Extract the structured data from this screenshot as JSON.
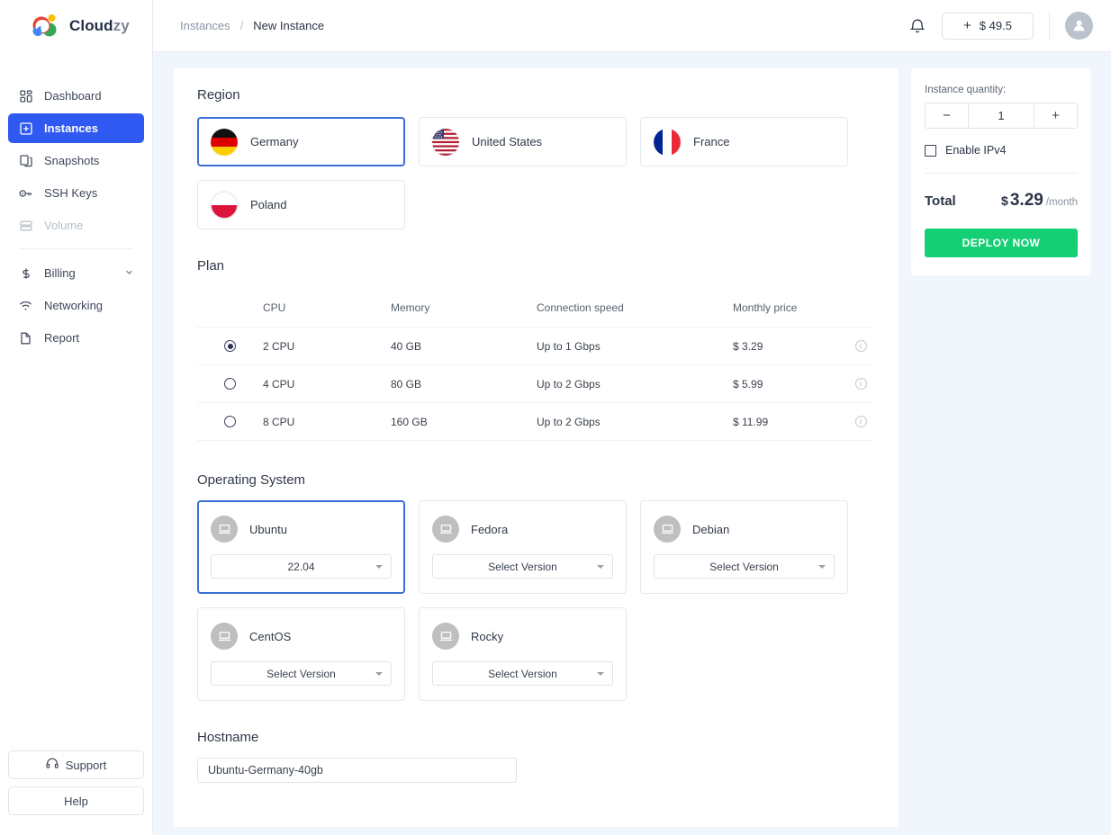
{
  "brand": {
    "name_main": "Cloud",
    "name_accent": "zy",
    "logo_icon": "cloudzy-logo-icon"
  },
  "topbar": {
    "breadcrumb": {
      "parent": "Instances",
      "separator": "/",
      "current": "New Instance"
    },
    "bell_icon": "notification-bell-icon",
    "credit": {
      "plus": "+",
      "amount": "$ 49.5"
    },
    "avatar_icon": "user-avatar-icon"
  },
  "sidebar": {
    "items": [
      {
        "label": "Dashboard",
        "icon": "dashboard-grid-icon",
        "state": "default"
      },
      {
        "label": "Instances",
        "icon": "instances-plus-box-icon",
        "state": "active"
      },
      {
        "label": "Snapshots",
        "icon": "snapshots-copy-icon",
        "state": "default"
      },
      {
        "label": "SSH Keys",
        "icon": "ssh-key-icon",
        "state": "default"
      },
      {
        "label": "Volume",
        "icon": "volume-storage-icon",
        "state": "disabled"
      },
      {
        "label": "Billing",
        "icon": "billing-dollar-icon",
        "state": "default",
        "chevron": "chevron-down-icon"
      },
      {
        "label": "Networking",
        "icon": "networking-wifi-icon",
        "state": "default"
      },
      {
        "label": "Report",
        "icon": "report-document-icon",
        "state": "default"
      }
    ],
    "support_label": "Support",
    "support_icon": "headset-icon",
    "help_label": "Help"
  },
  "sections": {
    "region_title": "Region",
    "plan_title": "Plan",
    "os_title": "Operating System",
    "hostname_title": "Hostname"
  },
  "regions": [
    {
      "label": "Germany",
      "flag": "flag-germany",
      "selected": true
    },
    {
      "label": "United States",
      "flag": "flag-united-states",
      "selected": false
    },
    {
      "label": "France",
      "flag": "flag-france",
      "selected": false
    },
    {
      "label": "Poland",
      "flag": "flag-poland",
      "selected": false
    }
  ],
  "plan_table": {
    "columns": [
      "",
      "CPU",
      "Memory",
      "Connection speed",
      "Monthly price",
      ""
    ],
    "rows": [
      {
        "selected": true,
        "cpu": "2 CPU",
        "memory": "40 GB",
        "speed": "Up to 1 Gbps",
        "price": "$ 3.29",
        "info_icon": "info-circle-icon"
      },
      {
        "selected": false,
        "cpu": "4 CPU",
        "memory": "80 GB",
        "speed": "Up to 2 Gbps",
        "price": "$ 5.99",
        "info_icon": "info-circle-icon"
      },
      {
        "selected": false,
        "cpu": "8 CPU",
        "memory": "160 GB",
        "speed": "Up to 2 Gbps",
        "price": "$ 11.99",
        "info_icon": "info-circle-icon"
      }
    ]
  },
  "operating_systems": [
    {
      "name": "Ubuntu",
      "version": "22.04",
      "selected": true,
      "icon": "os-monitor-icon"
    },
    {
      "name": "Fedora",
      "version": "Select Version",
      "selected": false,
      "icon": "os-monitor-icon"
    },
    {
      "name": "Debian",
      "version": "Select Version",
      "selected": false,
      "icon": "os-monitor-icon"
    },
    {
      "name": "CentOS",
      "version": "Select Version",
      "selected": false,
      "icon": "os-monitor-icon"
    },
    {
      "name": "Rocky",
      "version": "Select Version",
      "selected": false,
      "icon": "os-monitor-icon"
    }
  ],
  "hostname": {
    "value": "Ubuntu-Germany-40gb",
    "placeholder": "Hostname"
  },
  "summary": {
    "quantity_label": "Instance quantity:",
    "minus": "−",
    "quantity": "1",
    "plus": "+",
    "ipv4_label": "Enable IPv4",
    "ipv4_checked": false,
    "total_label": "Total",
    "currency": "$",
    "amount": "3.29",
    "period": "/month",
    "deploy_label": "DEPLOY NOW"
  },
  "colors": {
    "accent_blue": "#2f59f0",
    "select_border": "#3b6fd4",
    "deploy_green": "#15cf74",
    "canvas_bg": "#f1f6fd",
    "text_dark": "#2b3445"
  }
}
